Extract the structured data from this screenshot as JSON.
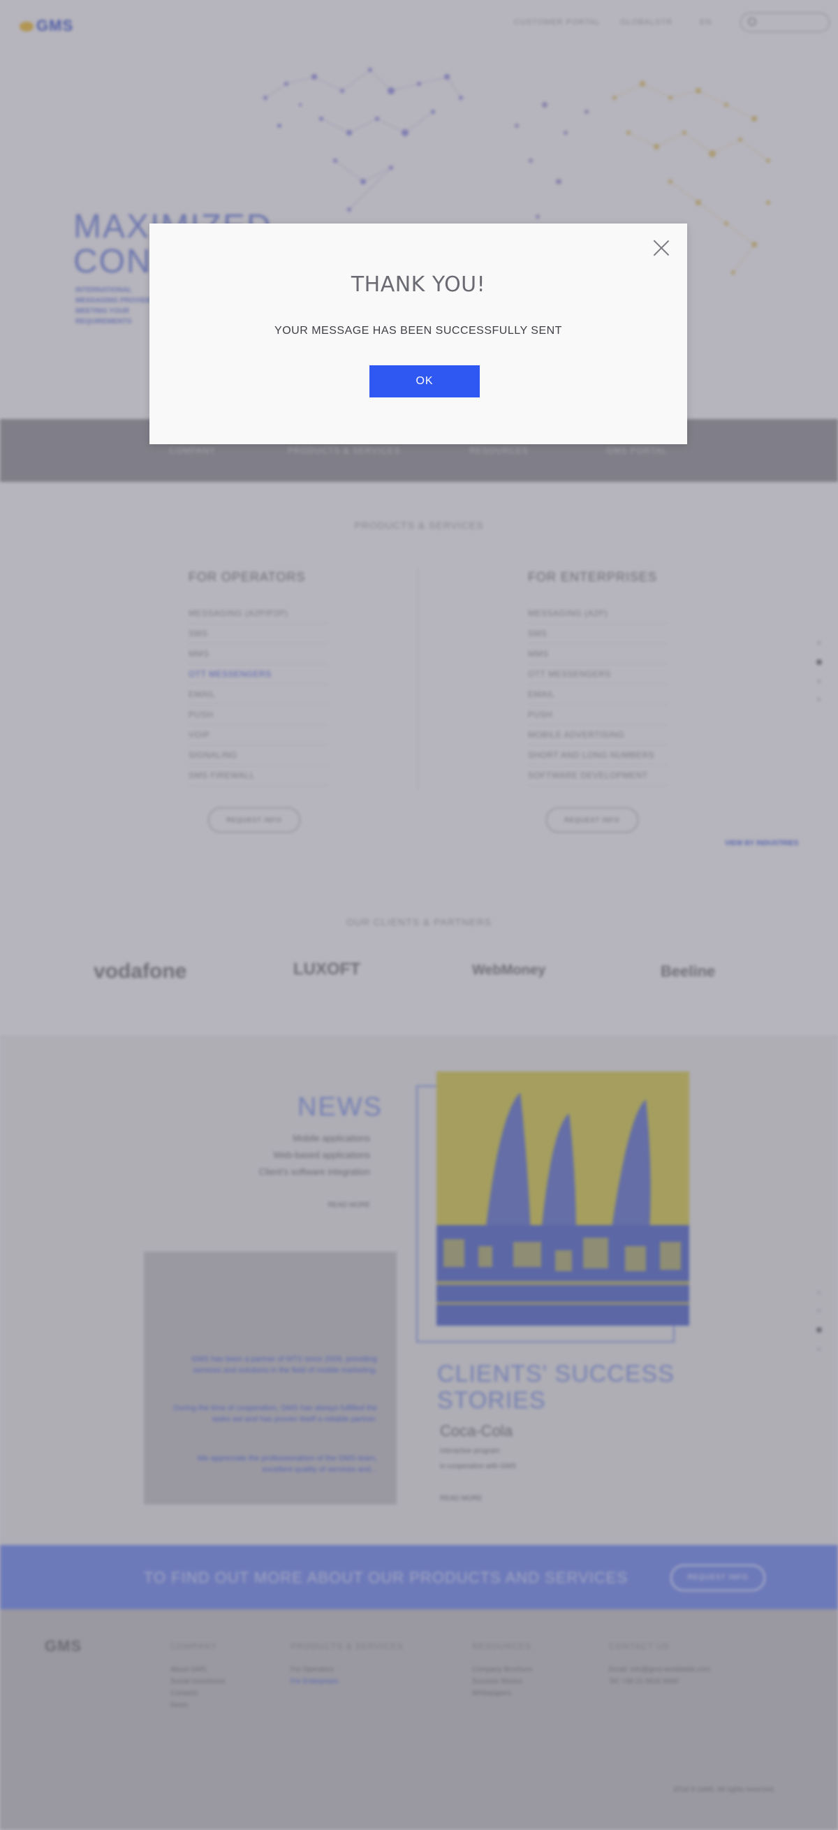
{
  "header": {
    "logo": "GMS",
    "nav": [
      "CUSTOMER PORTAL",
      "GLOBALSTR",
      "EN"
    ]
  },
  "hero": {
    "title_line1": "MAXIMIZED",
    "title_line2": "CONN",
    "subtitle": "INTERNATIONAL MESSAGING PROVIDER MEETING YOUR REQUIREMENTS"
  },
  "band": {
    "items": [
      "COMPANY",
      "PRODUCTS & SERVICES",
      "RESOURCES",
      "GMS PORTAL"
    ]
  },
  "products": {
    "title": "PRODUCTS & SERVICES",
    "operators": {
      "heading": "FOR OPERATORS",
      "items": [
        "MESSAGING (A2P/P2P)",
        "SMS",
        "MMS",
        "OTT MESSENGERS",
        "EMAIL",
        "PUSH",
        "VOIP",
        "SIGNALING",
        "SMS FIREWALL"
      ],
      "button": "REQUEST INFO"
    },
    "enterprises": {
      "heading": "FOR ENTERPRISES",
      "items": [
        "MESSAGING (A2P)",
        "SMS",
        "MMS",
        "OTT MESSENGERS",
        "EMAIL",
        "PUSH",
        "MOBILE ADVERTISING",
        "SHORT AND LONG NUMBERS",
        "SOFTWARE DEVELOPMENT"
      ],
      "button": "REQUEST INFO"
    },
    "view_link": "VIEW BY INDUSTRIES"
  },
  "clients": {
    "title": "OUR CLIENTS & PARTNERS",
    "logos": [
      "vodafone",
      "LUXOFT",
      "WebMoney",
      "Beeline"
    ]
  },
  "news": {
    "title": "NEWS",
    "lines": [
      "Mobile applications",
      "Web-based applications",
      "Client's software integration"
    ],
    "read_more": "READ MORE",
    "quote": [
      "GMS has been a partner of MTS since 2009, providing services and solutions in the field of mobile marketing.",
      "During the time of cooperation, GMS has always fulfilled the tasks set and has proven itself a reliable partner.",
      "We appreciate the professionalism of the GMS team, excellent quality of services and..."
    ]
  },
  "stories": {
    "title_line1": "CLIENTS' SUCCESS",
    "title_line2": "STORIES",
    "client": "Coca-Cola",
    "sub1": "interactive program",
    "sub2": "in cooperation with GMS",
    "read_more": "READ MORE"
  },
  "cta": {
    "text": "TO FIND OUT MORE ABOUT OUR PRODUCTS AND SERVICES",
    "button": "REQUEST INFO"
  },
  "footer": {
    "logo": "GMS",
    "company": {
      "heading": "COMPANY",
      "items": [
        "About GMS",
        "Social investment",
        "Contacts",
        "News"
      ]
    },
    "products": {
      "heading": "PRODUCTS & SERVICES",
      "items": [
        "For Operators",
        "For Enterprises"
      ]
    },
    "resources": {
      "heading": "RESOURCES",
      "items": [
        "Company Brochure",
        "Success Stories",
        "Whitepapers"
      ]
    },
    "contact": {
      "heading": "CONTACT US",
      "items": [
        "Email: info@gms-worldwide.com",
        "Tel: +30 21 0616 6600"
      ]
    },
    "copyright": "2018 © GMS. All rights reserved."
  },
  "modal": {
    "title": "THANK YOU!",
    "message": "YOUR MESSAGE HAS BEEN SUCCESSFULLY SENT",
    "ok": "OK"
  }
}
